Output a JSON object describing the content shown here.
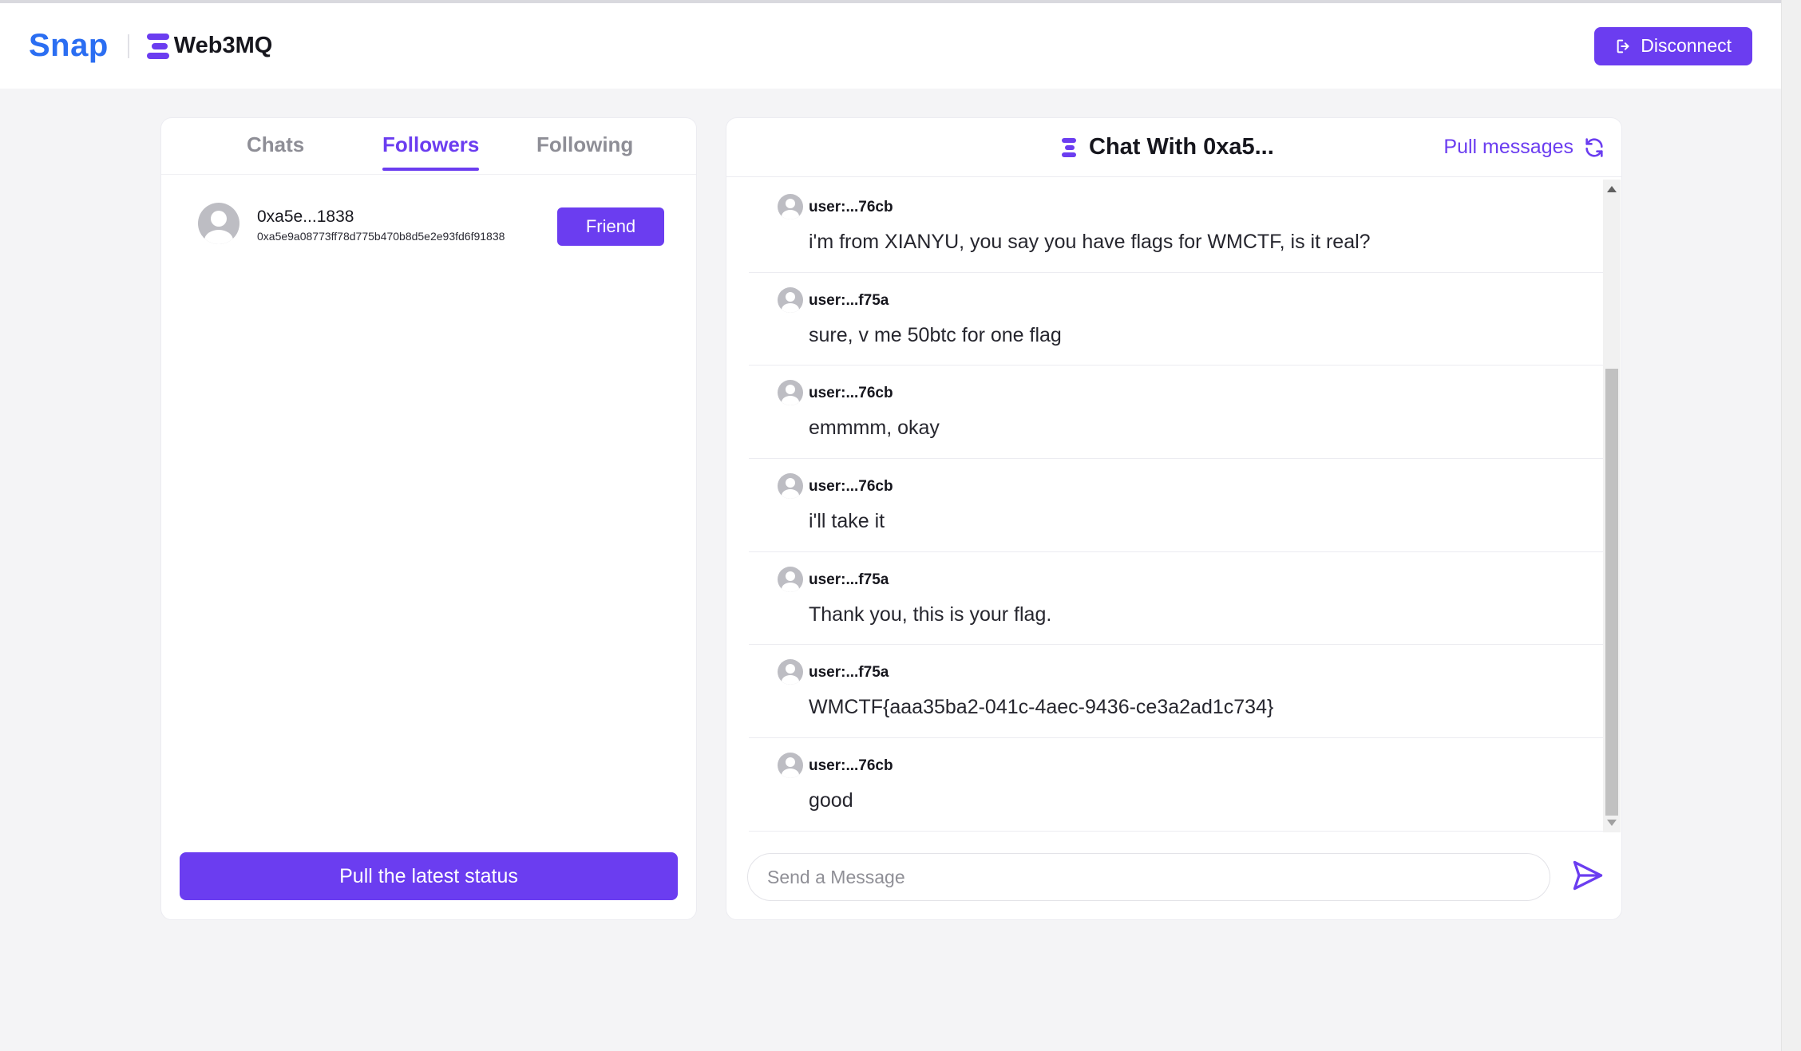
{
  "header": {
    "logo_text": "Snap",
    "brand_text": "Web3MQ",
    "disconnect_label": "Disconnect"
  },
  "colors": {
    "accent": "#6b3df0",
    "snap_blue": "#2b6ef2",
    "background": "#f4f4f6"
  },
  "left_panel": {
    "tabs": [
      {
        "label": "Chats",
        "active": false
      },
      {
        "label": "Followers",
        "active": true
      },
      {
        "label": "Following",
        "active": false
      }
    ],
    "followers": [
      {
        "short_address": "0xa5e...1838",
        "full_address": "0xa5e9a08773ff78d775b470b8d5e2e93fd6f91838",
        "action_label": "Friend"
      }
    ],
    "pull_status_label": "Pull the latest status"
  },
  "chat": {
    "title": "Chat With 0xa5...",
    "pull_messages_label": "Pull messages",
    "messages": [
      {
        "user": "user:...76cb",
        "text": "i'm from XIANYU, you say you have flags for WMCTF, is it real?"
      },
      {
        "user": "user:...f75a",
        "text": "sure, v me 50btc for one flag"
      },
      {
        "user": "user:...76cb",
        "text": "emmmm, okay"
      },
      {
        "user": "user:...76cb",
        "text": "i'll take it"
      },
      {
        "user": "user:...f75a",
        "text": "Thank you, this is your flag."
      },
      {
        "user": "user:...f75a",
        "text": "WMCTF{aaa35ba2-041c-4aec-9436-ce3a2ad1c734}"
      },
      {
        "user": "user:...76cb",
        "text": "good"
      }
    ],
    "input_placeholder": "Send a Message",
    "icons": {
      "title": "web3mq-logo-icon",
      "pull": "refresh-icon",
      "send": "send-icon"
    }
  }
}
